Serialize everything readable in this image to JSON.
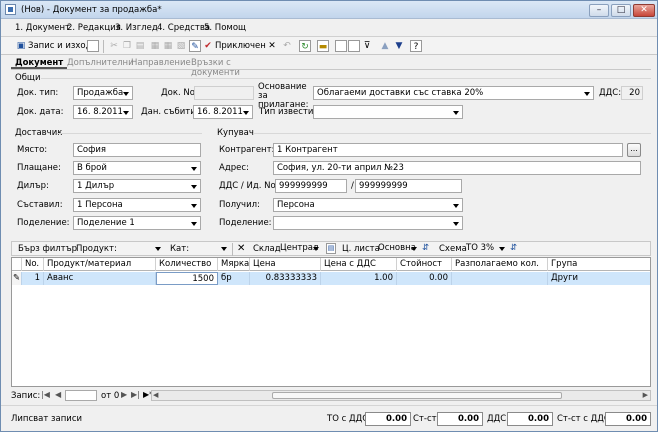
{
  "window": {
    "title": "(Нов) - Документ за продажба*"
  },
  "menu": [
    "1. Документ",
    "2. Редакция",
    "3. Изглед",
    "4. Средства",
    "5. Помощ"
  ],
  "toolbar": {
    "save_close": "Запис и изход",
    "apply": "Приключен"
  },
  "tabs": [
    "Документ",
    "Допълнителни",
    "Направление",
    "Връзки с документи"
  ],
  "general": {
    "title": "Общи",
    "doc_type_label": "Док. тип:",
    "doc_type": "Продажба",
    "doc_no_label": "Док. No.",
    "doc_no": "",
    "vat_basis_label": "Основание за прилагане:",
    "vat_basis": "Облагаеми доставки със ставка 20%",
    "vat_label": "ДДС:",
    "vat": "20",
    "doc_date_label": "Док. дата:",
    "doc_date": "16. 8.2011",
    "tax_event_label": "Дан. събитие:",
    "tax_event": "16. 8.2011",
    "notice_type_label": "Тип известие:",
    "notice_type": ""
  },
  "supplier": {
    "title": "Доставчик",
    "place_label": "Място:",
    "place": "София",
    "payment_label": "Плащане:",
    "payment": "В брой",
    "dealer_label": "Дилър:",
    "dealer": "1 Дилър",
    "creator_label": "Съставил:",
    "creator": "1 Персона",
    "division_label": "Поделение:",
    "division": "Поделение 1"
  },
  "buyer": {
    "title": "Купувач",
    "partner_label": "Контрагент:",
    "partner": "1 Контрагент",
    "address_label": "Адрес:",
    "address": "София, ул. 20-ти април №23",
    "vat_id_label": "ДДС / Ид. No.",
    "vat_no": "999999999",
    "slash": "/",
    "id_no": "999999999",
    "receiver_label": "Получил:",
    "receiver": "Персона",
    "division_label": "Поделение:",
    "division": ""
  },
  "filter": {
    "quick": "Бърз филтър",
    "product_label": "Продукт:",
    "product": "",
    "cat_label": "Кат:",
    "cat": "",
    "store_label": "Склад",
    "store": "Централ",
    "price_list_label": "Ц. листа",
    "price_list": "Основна",
    "scheme_label": "Схема",
    "scheme": "ТО 3%"
  },
  "grid": {
    "columns": [
      "No.",
      "Продукт/материал",
      "Количество",
      "Мярка",
      "Цена",
      "Цена с ДДС",
      "Стойност",
      "Разполагаемо кол.",
      "Група"
    ],
    "rows": [
      {
        "no": "1",
        "product": "Аванс",
        "qty": "1500",
        "unit": "бр",
        "price": "0.83333333",
        "price_vat": "1.00",
        "value": "0.00",
        "available": "",
        "group": "Други"
      }
    ]
  },
  "nav": {
    "label": "Запис:",
    "of": "от 0"
  },
  "status": {
    "text": "Липсват записи",
    "to_vat_label": "ТО с ДДС:",
    "to_vat": "0.00",
    "st_label": "Ст-ст:",
    "st": "0.00",
    "vat_label": "ДДС:",
    "vat": "0.00",
    "st_vat_label": "Ст-ст с ДДС:",
    "st_vat": "0.00"
  }
}
